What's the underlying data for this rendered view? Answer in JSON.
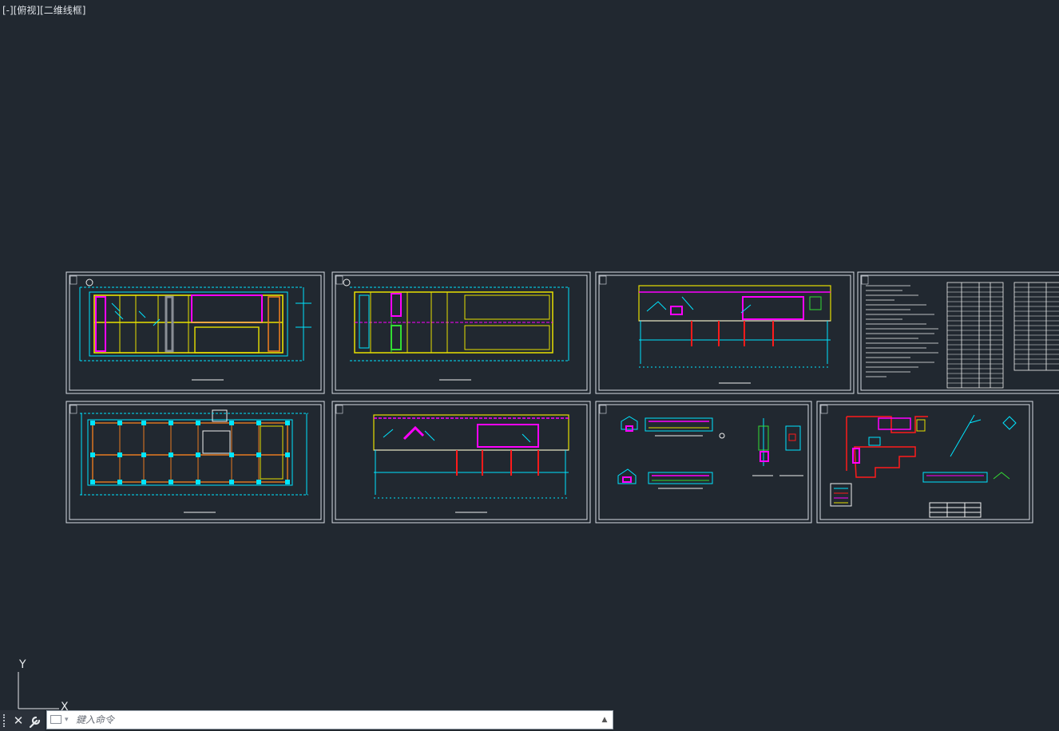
{
  "viewport": {
    "controls": {
      "minus": "[-]",
      "view": "[俯视]",
      "visual_style": "[二维线框]"
    }
  },
  "ucs": {
    "y_label": "Y",
    "x_label": "X"
  },
  "command_line": {
    "placeholder": "鍵入命令",
    "close_glyph": "✕",
    "history_glyph": "▲"
  },
  "colors": {
    "background": "#212830",
    "frame": "#d8dde3",
    "cyan": "#00e5ff",
    "yellow": "#e8e000",
    "magenta": "#ff00ff",
    "red": "#ff1a1a",
    "green": "#33dd33",
    "orange": "#e87a20",
    "white": "#f0f0f0"
  }
}
